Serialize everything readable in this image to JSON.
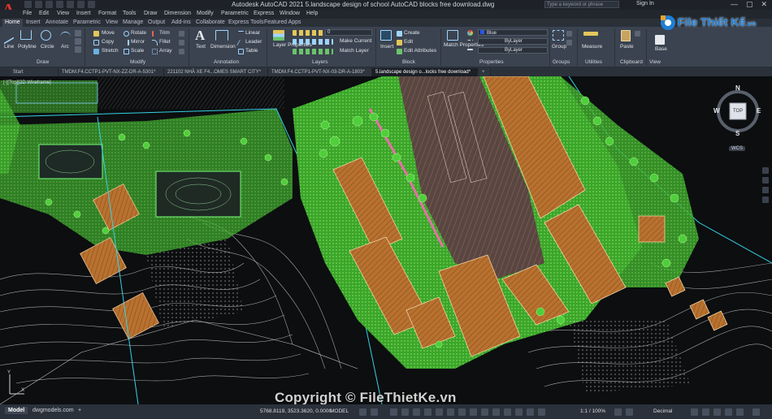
{
  "app": {
    "title": "Autodesk AutoCAD 2021   5.landscape design of school AutoCAD blocks free download.dwg",
    "search_placeholder": "Type a keyword or phrase",
    "signin": "Sign In",
    "logo_letter": "A"
  },
  "menus": [
    "File",
    "Edit",
    "View",
    "Insert",
    "Format",
    "Tools",
    "Draw",
    "Dimension",
    "Modify",
    "Parametric",
    "Express",
    "Window",
    "Help"
  ],
  "ribbon_tabs": [
    "Home",
    "Insert",
    "Annotate",
    "Parametric",
    "View",
    "Manage",
    "Output",
    "Add-ins",
    "Collaborate",
    "Express Tools",
    "Featured Apps"
  ],
  "ribbon": {
    "draw": {
      "label": "Draw",
      "tools": [
        "Line",
        "Polyline",
        "Circle",
        "Arc"
      ]
    },
    "modify": {
      "label": "Modify",
      "tools": [
        "Move",
        "Rotate",
        "Trim",
        "Copy",
        "Mirror",
        "Fillet",
        "Stretch",
        "Scale",
        "Array"
      ]
    },
    "annotation": {
      "label": "Annotation",
      "tools": [
        "Text",
        "Dimension",
        "Linear",
        "Leader",
        "Table"
      ]
    },
    "layers": {
      "label": "Layers",
      "tools": [
        "Layer Properties",
        "Make Current",
        "Match Layer"
      ],
      "current_layer": "0"
    },
    "block": {
      "label": "Block",
      "tools": [
        "Insert",
        "Create",
        "Edit",
        "Edit Attributes"
      ]
    },
    "properties": {
      "label": "Properties",
      "tools": [
        "Match Properties"
      ],
      "color": "Blue",
      "linetype": "ByLayer",
      "lineweight": "ByLayer"
    },
    "groups": {
      "label": "Groups",
      "tools": [
        "Group"
      ]
    },
    "utilities": {
      "label": "Utilities",
      "tools": [
        "Measure"
      ]
    },
    "clipboard": {
      "label": "Clipboard",
      "tools": [
        "Paste"
      ]
    },
    "view": {
      "label": "View",
      "tools": [
        "Base"
      ]
    }
  },
  "file_tabs": [
    {
      "label": "Start",
      "active": false
    },
    {
      "label": "TMDM.F4.CCTP1-PVT-NX-ZZ-DR-A-5301*",
      "active": false
    },
    {
      "label": "221102 NHÀ XE F4...OMES SMART CITY*",
      "active": false
    },
    {
      "label": "TMDM.F4.CCTP1-PVT-NX-03-DR-A-1803*",
      "active": false
    },
    {
      "label": "5.landscape design o...locks free download*",
      "active": true
    }
  ],
  "viewport_label": "[-][Top][2D Wireframe]",
  "viewcube": {
    "face": "TOP",
    "north": "N",
    "south": "S",
    "east": "E",
    "west": "W",
    "wcs": "WCS"
  },
  "layout_tabs": [
    {
      "label": "Model",
      "active": true
    },
    {
      "label": "dwgmodels.com",
      "active": false
    }
  ],
  "status": {
    "coords": "5768.8119, 3523.3620, 0.0000",
    "space": "MODEL",
    "scale": "1:1 / 100%",
    "units": "Decimal"
  },
  "watermark": {
    "brand": "File Thiết Kế",
    "brand_suffix": ".vn",
    "copyright": "Copyright © FileThietKe.vn"
  },
  "colors": {
    "accent_red": "#e8322f",
    "ribbon_bg": "#3b4350",
    "roof_brown": "#c47a35",
    "lawn_green": "#52c43a",
    "cad_black": "#0c0e10"
  }
}
